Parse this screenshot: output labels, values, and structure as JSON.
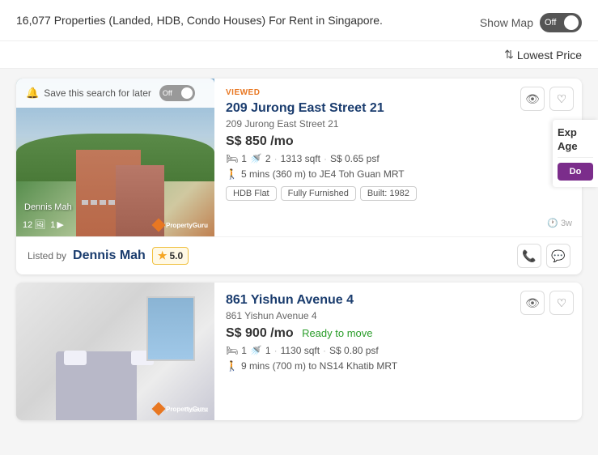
{
  "header": {
    "title": "16,077 Properties (Landed, HDB, Condo Houses) For Rent in Singapore.",
    "show_map_label": "Show Map",
    "toggle_state": "Off"
  },
  "sort": {
    "label": "Lowest Price",
    "icon": "⇅"
  },
  "listing1": {
    "save_search_label": "Save this search for later",
    "save_toggle": "Off",
    "viewed_label": "VIEWED",
    "title": "209 Jurong East Street 21",
    "address": "209 Jurong East Street 21",
    "price": "S$ 850 /mo",
    "bedrooms": "1",
    "bathrooms": "2",
    "sqft": "1313 sqft",
    "psf": "S$ 0.65 psf",
    "transit": "5 mins (360 m) to JE4 Toh Guan MRT",
    "tags": [
      "HDB Flat",
      "Fully Furnished",
      "Built: 1982"
    ],
    "timestamp": "3w",
    "image_count": "12",
    "has_video": true,
    "agent_name": "Dennis Mah",
    "listed_by": "Listed by",
    "rating": "5.0"
  },
  "listing2": {
    "title": "861 Yishun Avenue 4",
    "address": "861 Yishun Avenue 4",
    "price": "S$ 900 /mo",
    "ready_label": "Ready to move",
    "bedrooms": "1",
    "bathrooms": "1",
    "sqft": "1130 sqft",
    "psf": "S$ 0.80 psf",
    "transit": "9 mins (700 m) to NS14 Khatib MRT"
  },
  "right_panel": {
    "exp_label": "Exp",
    "agent_label": "Age",
    "do_button": "Do"
  }
}
